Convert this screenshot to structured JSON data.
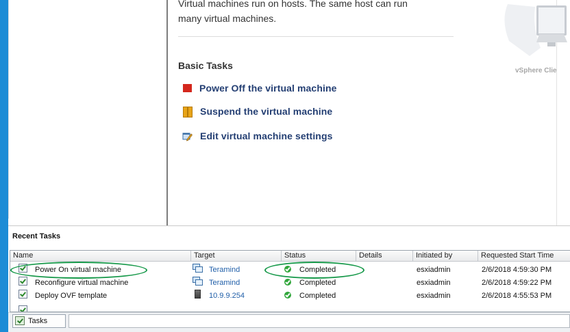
{
  "summary": {
    "intro_line1": "Virtual machines run on hosts. The same host can run",
    "intro_line2": "many virtual machines.",
    "basic_tasks_title": "Basic Tasks",
    "tasks": [
      {
        "label": "Power Off the virtual machine",
        "icon": "power-off-icon"
      },
      {
        "label": "Suspend the virtual machine",
        "icon": "suspend-icon"
      },
      {
        "label": "Edit virtual machine settings",
        "icon": "edit-settings-icon"
      }
    ],
    "vsphere_label": "vSphere Clie"
  },
  "recent_tasks": {
    "title": "Recent Tasks",
    "columns": [
      "Name",
      "Target",
      "Status",
      "Details",
      "Initiated by",
      "Requested Start Time"
    ],
    "rows": [
      {
        "name": "Power On virtual machine",
        "target": "Teramind",
        "target_icon": "vm-icon",
        "status": "Completed",
        "details": "",
        "initiated_by": "esxiadmin",
        "start_time": "2/6/2018 4:59:30 PM"
      },
      {
        "name": "Reconfigure virtual machine",
        "target": "Teramind",
        "target_icon": "vm-icon",
        "status": "Completed",
        "details": "",
        "initiated_by": "esxiadmin",
        "start_time": "2/6/2018 4:59:22 PM"
      },
      {
        "name": "Deploy OVF template",
        "target": "10.9.9.254",
        "target_icon": "host-icon",
        "status": "Completed",
        "details": "",
        "initiated_by": "esxiadmin",
        "start_time": "2/6/2018 4:55:53 PM"
      }
    ]
  },
  "bottom_tabs": {
    "tasks_label": "Tasks"
  },
  "colors": {
    "link": "#243f73",
    "highlight_ring": "#17994a",
    "status_ok": "#31a63b",
    "frame": "#1d8cd6"
  }
}
